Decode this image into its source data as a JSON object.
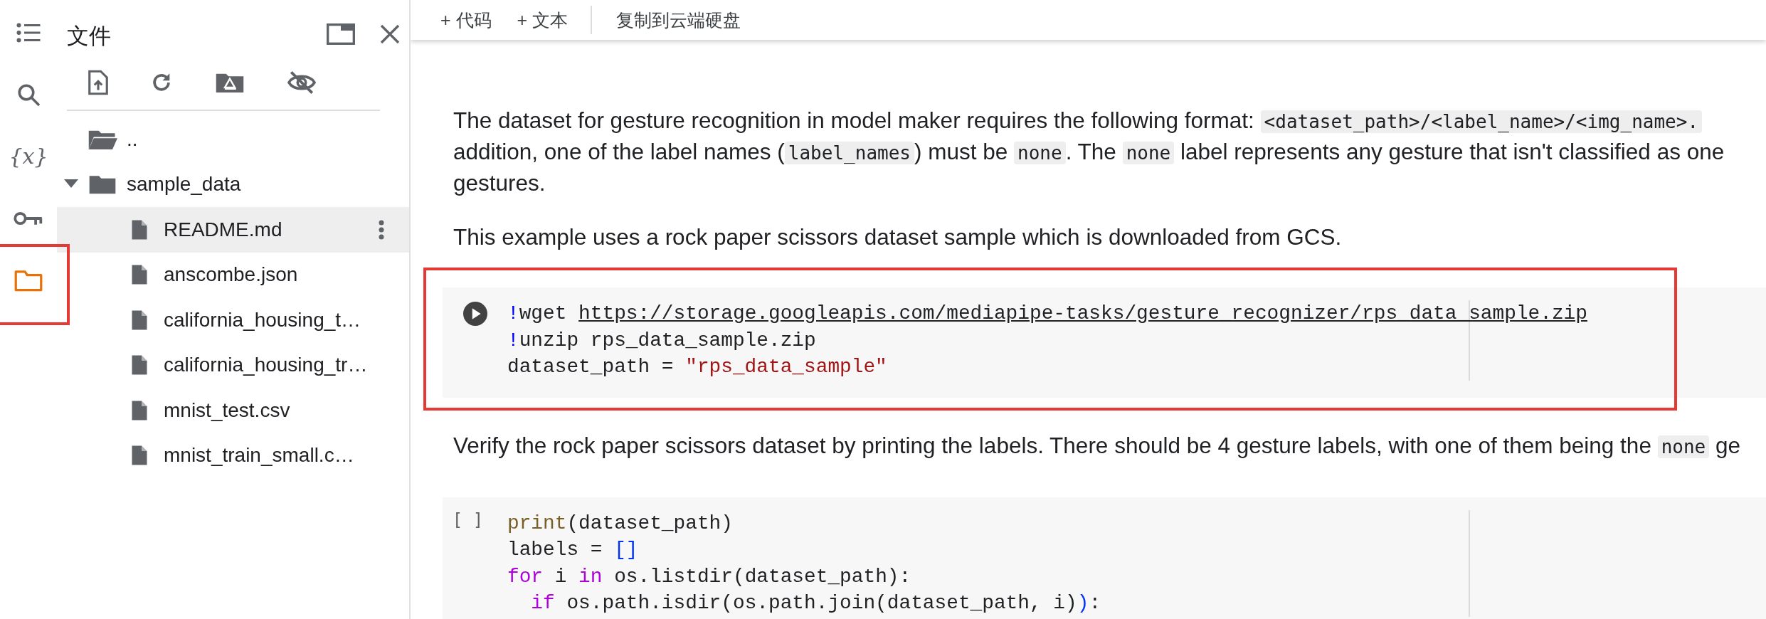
{
  "rail": [
    {
      "kind": "toc",
      "selected": false,
      "annotated": false
    },
    {
      "kind": "search",
      "selected": false,
      "annotated": false
    },
    {
      "kind": "variables",
      "glyph": "{x}",
      "selected": false,
      "annotated": false
    },
    {
      "kind": "key",
      "selected": false,
      "annotated": false
    },
    {
      "kind": "folder",
      "selected": true,
      "annotated": true
    }
  ],
  "files_panel": {
    "title": "文件",
    "tree": [
      {
        "name": "..",
        "kind": "folder-open",
        "selected": false
      },
      {
        "name": "sample_data",
        "kind": "folder",
        "expanded": true,
        "selected": false,
        "children": [
          {
            "name": "README.md",
            "kind": "file",
            "selected": true
          },
          {
            "name": "anscombe.json",
            "kind": "file",
            "selected": false
          },
          {
            "name": "california_housing_t…",
            "kind": "file",
            "selected": false
          },
          {
            "name": "california_housing_tr…",
            "kind": "file",
            "selected": false
          },
          {
            "name": "mnist_test.csv",
            "kind": "file",
            "selected": false
          },
          {
            "name": "mnist_train_small.c…",
            "kind": "file",
            "selected": false
          }
        ]
      }
    ]
  },
  "toolbar": {
    "buttons": [
      {
        "label": "+ 代码"
      },
      {
        "label": "+ 文本"
      }
    ],
    "copy_button": "复制到云端硬盘"
  },
  "notebook": [
    {
      "kind": "text",
      "lines": [
        [
          {
            "kind": "plain",
            "text": "The dataset for gesture recognition in model maker requires the following format: "
          },
          {
            "kind": "code",
            "text": "<dataset_path>/<label_name>/<img_name>."
          }
        ],
        [
          {
            "kind": "plain",
            "text": "addition, one of the label names ("
          },
          {
            "kind": "code",
            "text": "label_names"
          },
          {
            "kind": "plain",
            "text": ") must be "
          },
          {
            "kind": "code",
            "text": "none"
          },
          {
            "kind": "plain",
            "text": ". The "
          },
          {
            "kind": "code",
            "text": "none"
          },
          {
            "kind": "plain",
            "text": " label represents any gesture that isn't classified as one"
          }
        ],
        [
          {
            "kind": "plain",
            "text": "gestures."
          }
        ]
      ]
    },
    {
      "kind": "text",
      "lines": [
        [
          {
            "kind": "plain",
            "text": "This example uses a rock paper scissors dataset sample which is downloaded from GCS."
          }
        ]
      ]
    },
    {
      "kind": "code",
      "annotated": true,
      "lines": [
        [
          {
            "kind": "bang",
            "text": "!"
          },
          {
            "kind": "plain",
            "text": "wget "
          },
          {
            "kind": "link",
            "text": "https://storage.googleapis.com/mediapipe-tasks/gesture_recognizer/rps_data_sample.zip"
          }
        ],
        [
          {
            "kind": "bang",
            "text": "!"
          },
          {
            "kind": "plain",
            "text": "unzip rps_data_sample.zip"
          }
        ],
        [
          {
            "kind": "plain",
            "text": "dataset_path = "
          },
          {
            "kind": "string",
            "text": "\"rps_data_sample\""
          }
        ]
      ]
    },
    {
      "kind": "text",
      "lines": [
        [
          {
            "kind": "plain",
            "text": "Verify the rock paper scissors dataset by printing the labels. There should be 4 gesture labels, with one of them being the "
          },
          {
            "kind": "code",
            "text": "none"
          },
          {
            "kind": "plain",
            "text": " ge"
          }
        ]
      ]
    },
    {
      "kind": "code",
      "annotated": false,
      "prompt": "[ ]",
      "lines": [
        [
          {
            "kind": "function",
            "text": "print"
          },
          {
            "kind": "plain",
            "text": "(dataset_path)"
          }
        ],
        [
          {
            "kind": "plain",
            "text": "labels = "
          },
          {
            "kind": "bracket",
            "text": "[]"
          }
        ],
        [
          {
            "kind": "keyword",
            "text": "for"
          },
          {
            "kind": "plain",
            "text": " i "
          },
          {
            "kind": "keyword",
            "text": "in"
          },
          {
            "kind": "plain",
            "text": " os.listdir(dataset_path):"
          }
        ],
        [
          {
            "kind": "keyword",
            "text": "  if"
          },
          {
            "kind": "plain",
            "text": " os.path.isdir(os.path.join(dataset_path, i)"
          },
          {
            "kind": "bracket",
            "text": ")"
          },
          {
            "kind": "plain",
            "text": ":"
          }
        ]
      ]
    }
  ]
}
